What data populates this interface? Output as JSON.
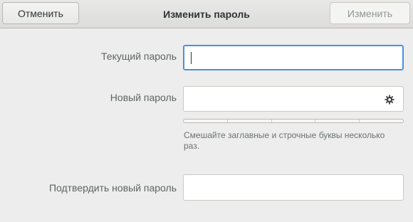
{
  "header": {
    "cancel_label": "Отменить",
    "title": "Изменить пароль",
    "apply_label": "Изменить"
  },
  "form": {
    "current_password_label": "Текущий пароль",
    "current_password_value": "",
    "new_password_label": "Новый пароль",
    "new_password_value": "",
    "generate_icon": "gear-icon",
    "strength_level": 0,
    "strength_segments": 5,
    "hint": "Смешайте заглавные и строчные буквы несколько раз.",
    "confirm_password_label": "Подтвердить новый пароль",
    "confirm_password_value": ""
  },
  "colors": {
    "focus_border": "#4a90d9",
    "background": "#ededed",
    "disabled_text": "#929595"
  }
}
